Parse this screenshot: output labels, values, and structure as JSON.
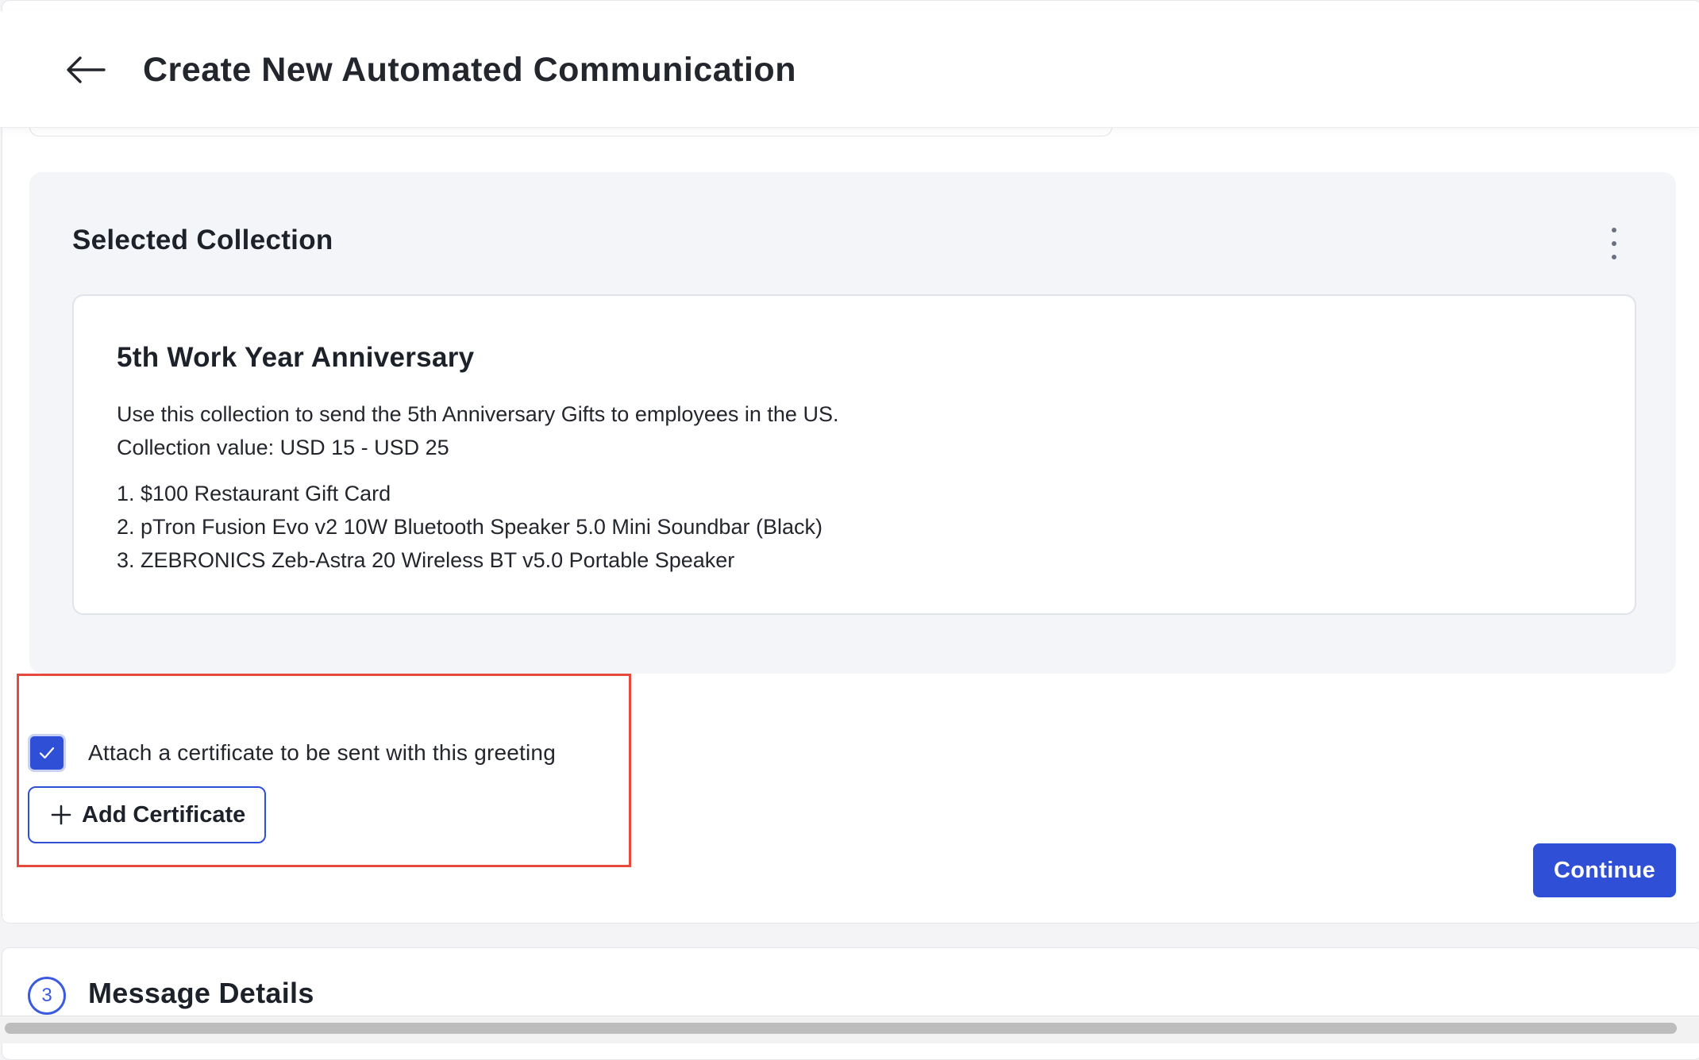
{
  "header": {
    "title": "Create New Automated Communication",
    "back_icon": "arrow-left-icon"
  },
  "collection": {
    "section_title": "Selected Collection",
    "menu_icon": "kebab-menu-icon",
    "name": "5th Work Year Anniversary",
    "description": "Use this collection to send the 5th Anniversary Gifts to employees in the US.",
    "value": "Collection value: USD 15 - USD 25",
    "items": [
      "1. $100 Restaurant Gift Card",
      "2. pTron Fusion Evo v2 10W Bluetooth Speaker 5.0 Mini Soundbar (Black)",
      "3. ZEBRONICS Zeb-Astra 20 Wireless BT v5.0 Portable Speaker"
    ]
  },
  "certificate": {
    "checkbox_label": "Attach a certificate to be sent with this greeting",
    "checked": true,
    "add_button_label": "Add Certificate"
  },
  "actions": {
    "continue_label": "Continue"
  },
  "next_step": {
    "number": "3",
    "title": "Message Details"
  },
  "colors": {
    "primary": "#2f50d6",
    "highlight": "#e54a3c",
    "panel_bg": "#f4f5f8"
  }
}
